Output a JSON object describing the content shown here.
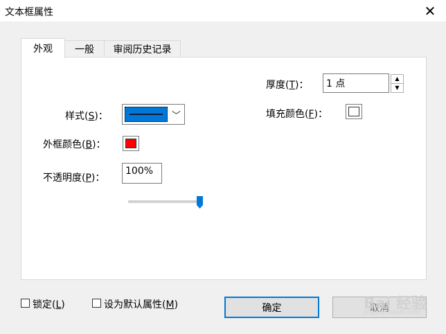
{
  "window": {
    "title": "文本框属性"
  },
  "tabs": [
    {
      "label": "外观",
      "active": true
    },
    {
      "label": "一般",
      "active": false
    },
    {
      "label": "审阅历史记录",
      "active": false
    }
  ],
  "appearance": {
    "style_label": "样式",
    "style_key": "S",
    "border_color_label": "外框颜色",
    "border_color_key": "B",
    "border_color": "#ff0000",
    "opacity_label": "不透明度",
    "opacity_key": "P",
    "opacity_value": "100%",
    "opacity_slider_fraction": 1.0,
    "thickness_label": "厚度",
    "thickness_key": "T",
    "thickness_value": "1 点",
    "fill_color_label": "填充颜色",
    "fill_color_key": "F",
    "fill_color": "#ffffff",
    "colon": "："
  },
  "footer": {
    "lock_label": "锁定",
    "lock_key": "L",
    "default_label": "设为默认属性",
    "default_key": "M",
    "ok_label": "确定",
    "cancel_label": "取消",
    "watermark": "Bai 经验",
    "watermark_sub": "jingyan.baidu.com"
  },
  "colors": {
    "accent": "#0078d7"
  }
}
